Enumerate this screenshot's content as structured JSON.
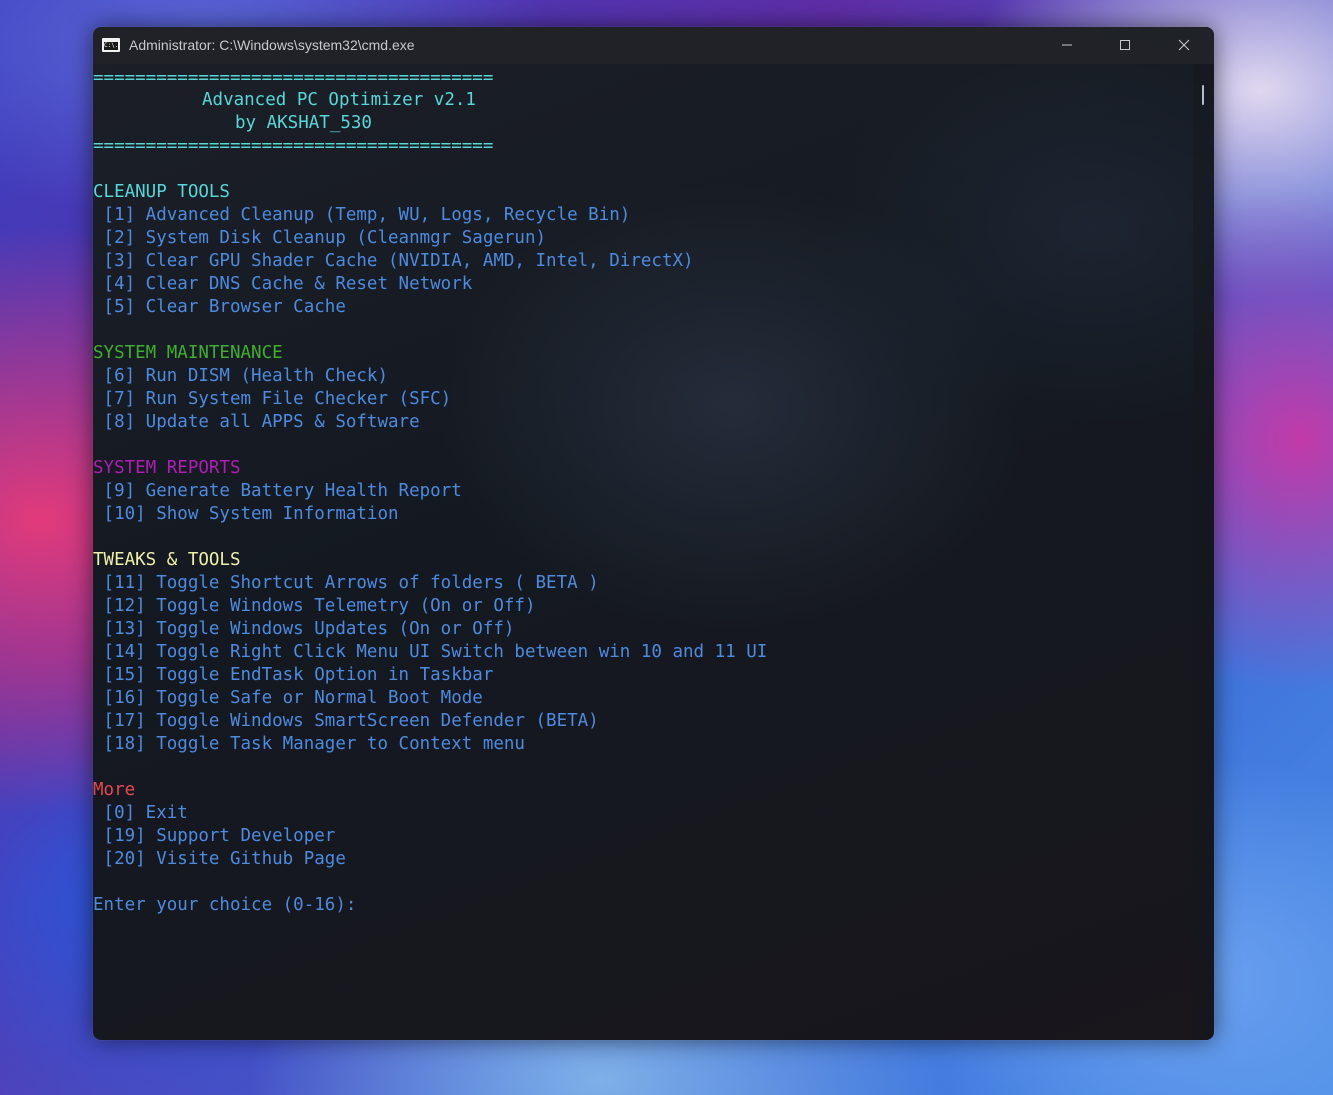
{
  "window": {
    "title": "Administrator: C:\\Windows\\system32\\cmd.exe",
    "icon_label": "C:\\."
  },
  "console": {
    "separator_top": "======================================",
    "app_title": "Advanced PC Optimizer v2.1",
    "author": "by AKSHAT_530",
    "separator_bottom": "======================================",
    "sections": {
      "cleanup": {
        "header": "CLEANUP TOOLS",
        "items": [
          " [1] Advanced Cleanup (Temp, WU, Logs, Recycle Bin)",
          " [2] System Disk Cleanup (Cleanmgr Sagerun)",
          " [3] Clear GPU Shader Cache (NVIDIA, AMD, Intel, DirectX)",
          " [4] Clear DNS Cache & Reset Network",
          " [5] Clear Browser Cache"
        ]
      },
      "maintenance": {
        "header": "SYSTEM MAINTENANCE",
        "items": [
          " [6] Run DISM (Health Check)",
          " [7] Run System File Checker (SFC)",
          " [8] Update all APPS & Software"
        ]
      },
      "reports": {
        "header": "SYSTEM REPORTS",
        "items": [
          " [9] Generate Battery Health Report",
          " [10] Show System Information"
        ]
      },
      "tweaks": {
        "header": "TWEAKS & TOOLS",
        "items": [
          " [11] Toggle Shortcut Arrows of folders ( BETA )",
          " [12] Toggle Windows Telemetry (On or Off)",
          " [13] Toggle Windows Updates (On or Off)",
          " [14] Toggle Right Click Menu UI Switch between win 10 and 11 UI",
          " [15] Toggle EndTask Option in Taskbar",
          " [16] Toggle Safe or Normal Boot Mode",
          " [17] Toggle Windows SmartScreen Defender (BETA)",
          " [18] Toggle Task Manager to Context menu"
        ]
      },
      "more": {
        "header": "More",
        "items": [
          " [0] Exit",
          " [19] Support Developer",
          " [20] Visite Github Page"
        ]
      }
    },
    "prompt": "Enter your choice (0-16):"
  },
  "colors": {
    "cyan": "#54d8d8",
    "green": "#3fb02b",
    "purple": "#b01cb4",
    "yellow": "#f0f0a8",
    "red": "#e34850",
    "blue": "#4c8be0"
  }
}
